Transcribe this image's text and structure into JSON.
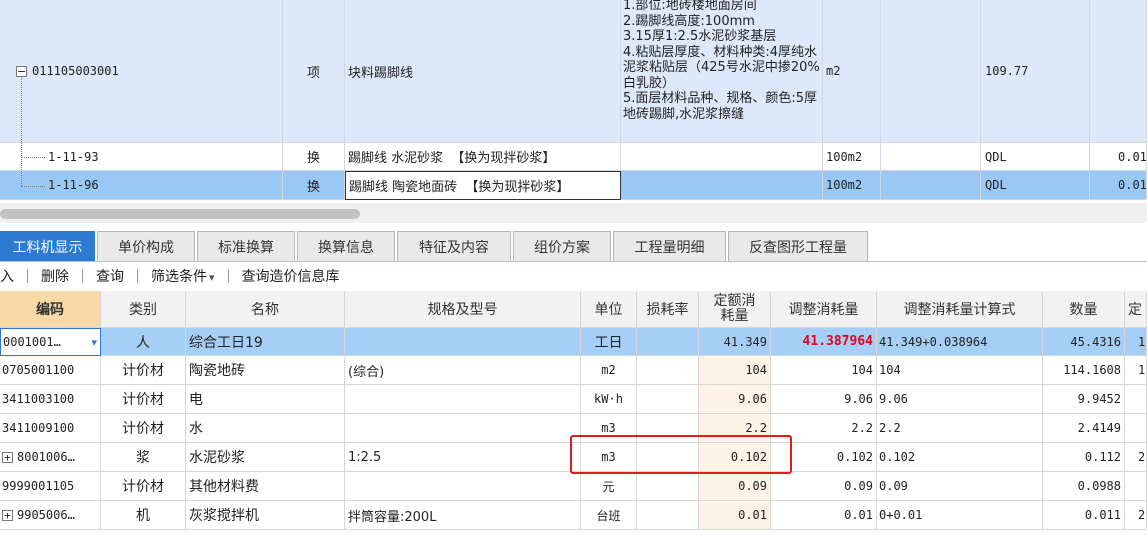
{
  "upper_rows": [
    {
      "code": "011105003001",
      "type": "项",
      "name": "块料踢脚线",
      "description": "1.部位:地砖楼地面房间\n2.踢脚线高度:100mm\n3.15厚1:2.5水泥砂浆基层\n4.粘贴层厚度、材料种类:4厚纯水泥浆粘贴层（425号水泥中掺20%白乳胶）\n5.面层材料品种、规格、颜色:5厚地砖踢脚,水泥浆擦缝",
      "unit": "m2",
      "quantity_expr": "109.77",
      "extra": ""
    },
    {
      "code": "1-11-93",
      "type": "换",
      "name": "踢脚线 水泥砂浆  【换为现拌砂浆】",
      "description": "",
      "unit": "100m2",
      "quantity_expr": "QDL",
      "extra": "0.01"
    },
    {
      "code": "1-11-96",
      "type": "换",
      "name": "踢脚线 陶瓷地面砖  【换为现拌砂浆】",
      "description": "",
      "unit": "100m2",
      "quantity_expr": "QDL",
      "extra": "0.01"
    }
  ],
  "tabs": [
    "工料机显示",
    "单价构成",
    "标准换算",
    "换算信息",
    "特征及内容",
    "组价方案",
    "工程量明细",
    "反查图形工程量"
  ],
  "toolbar": {
    "insert": "入",
    "delete": "删除",
    "query": "查询",
    "filter": "筛选条件",
    "filter_arrow": "▾",
    "query_price_db": "查询造价信息库"
  },
  "columns": [
    "编码",
    "类别",
    "名称",
    "规格及型号",
    "单位",
    "损耗率",
    "定额消耗量",
    "调整消耗量",
    "调整消耗量计算式",
    "数量",
    "定"
  ],
  "rows": [
    {
      "code": "0001001…",
      "category": "人",
      "name": "综合工日19",
      "spec": "",
      "unit": "工日",
      "loss": "",
      "quota": "41.349",
      "adjusted": "41.387964",
      "formula": "41.349+0.038964",
      "quantity": "45.4316",
      "extra": "1"
    },
    {
      "code": "0705001100",
      "category": "计价材",
      "name": "陶瓷地砖",
      "spec": "(综合)",
      "unit": "m2",
      "loss": "",
      "quota": "104",
      "adjusted": "104",
      "formula": "104",
      "quantity": "114.1608",
      "extra": "1"
    },
    {
      "code": "3411003100",
      "category": "计价材",
      "name": "电",
      "spec": "",
      "unit": "kW·h",
      "loss": "",
      "quota": "9.06",
      "adjusted": "9.06",
      "formula": "9.06",
      "quantity": "9.9452",
      "extra": ""
    },
    {
      "code": "3411009100",
      "category": "计价材",
      "name": "水",
      "spec": "",
      "unit": "m3",
      "loss": "",
      "quota": "2.2",
      "adjusted": "2.2",
      "formula": "2.2",
      "quantity": "2.4149",
      "extra": ""
    },
    {
      "code": "8001006…",
      "category": "浆",
      "name": "水泥砂浆",
      "spec": "1:2.5",
      "unit": "m3",
      "loss": "",
      "quota": "0.102",
      "adjusted": "0.102",
      "formula": "0.102",
      "quantity": "0.112",
      "extra": "2"
    },
    {
      "code": "9999001105",
      "category": "计价材",
      "name": "其他材料费",
      "spec": "",
      "unit": "元",
      "loss": "",
      "quota": "0.09",
      "adjusted": "0.09",
      "formula": "0.09",
      "quantity": "0.0988",
      "extra": ""
    },
    {
      "code": "9905006…",
      "category": "机",
      "name": "灰浆搅拌机",
      "spec": "拌筒容量:200L",
      "unit": "台班",
      "loss": "",
      "quota": "0.01",
      "adjusted": "0.01",
      "formula": "0+0.01",
      "quantity": "0.011",
      "extra": "2"
    }
  ],
  "icons": {
    "expand": "⊞",
    "collapse": "⊟",
    "dropdown": "▾"
  },
  "colors": {
    "active_tab": "#2f7ad1",
    "selected_row": "#99c8f5",
    "highlight_red": "#e8001c",
    "red_box": "#e31b1b"
  }
}
